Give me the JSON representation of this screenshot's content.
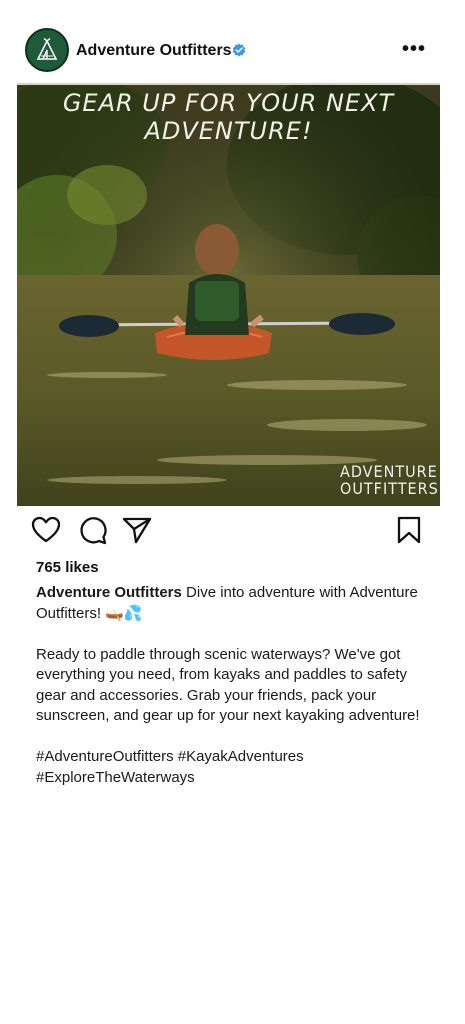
{
  "post": {
    "account": "Adventure Outfitters",
    "more_label": "•••",
    "image": {
      "headline": "GEAR UP FOR YOUR NEXT ADVENTURE!",
      "watermark_line1": "ADVENTURE",
      "watermark_line2": "OUTFITTERS"
    },
    "likes": "765 likes",
    "caption": {
      "username": "Adventure Outfitters",
      "intro": "Dive into adventure with Adventure Outfitters! 🛶💦",
      "body": "Ready to paddle through scenic waterways? We've got everything you need, from kayaks and paddles to safety gear and accessories. Grab your friends, pack your sunscreen, and gear up for your next kayaking adventure!",
      "hashtags": "#AdventureOutfitters #KayakAdventures #ExploreTheWaterways"
    }
  },
  "icons": {
    "avatar": "tent-logo-icon",
    "verified": "verified-badge-icon",
    "like": "heart-icon",
    "comment": "comment-bubble-icon",
    "share": "paper-plane-icon",
    "save": "bookmark-icon"
  },
  "colors": {
    "brand_green": "#1e5b3a",
    "verified_blue": "#3897f0"
  }
}
